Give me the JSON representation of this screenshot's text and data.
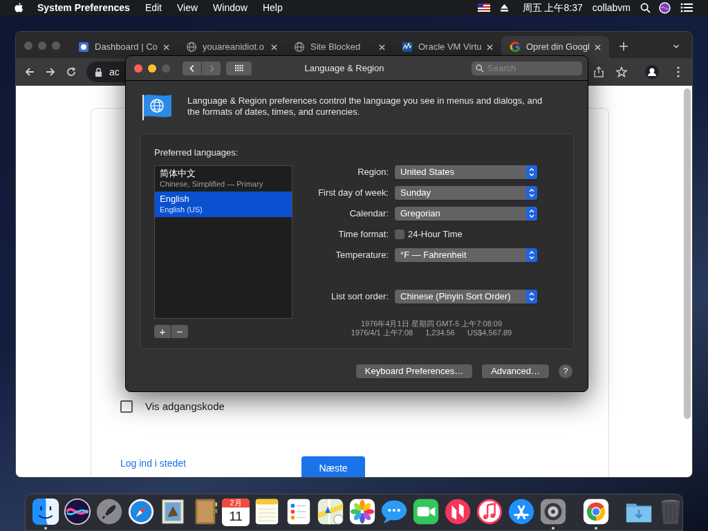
{
  "menubar": {
    "app": "System Preferences",
    "menus": [
      "Edit",
      "View",
      "Window",
      "Help"
    ],
    "clock": "周五 上午8:37",
    "user": "collabvm"
  },
  "browser": {
    "tabs": [
      {
        "title": "Dashboard | Co",
        "kind": "app",
        "selected": false
      },
      {
        "title": "youareanidiot.o",
        "kind": "globe",
        "selected": false
      },
      {
        "title": "Site Blocked",
        "kind": "globe",
        "selected": false
      },
      {
        "title": "Oracle VM Virtu",
        "kind": "chart",
        "selected": false
      },
      {
        "title": "Opret din Googl",
        "kind": "ring",
        "selected": true
      }
    ],
    "address": "ac",
    "page": {
      "show_password": {
        "label": "Vis adgangskode",
        "checked": false
      },
      "link": "Log ind i stedet",
      "next_button": "Næste"
    }
  },
  "prefs": {
    "title": "Language & Region",
    "search_placeholder": "Search",
    "nav": {
      "back_disabled": false,
      "forward_disabled": true
    },
    "description": "Language & Region preferences control the language you see in menus and dialogs, and the formats of dates, times, and currencies.",
    "preferred_label": "Preferred languages:",
    "languages": [
      {
        "name": "简体中文",
        "detail": "Chinese, Simplified — Primary",
        "selected": false
      },
      {
        "name": "English",
        "detail": "English (US)",
        "selected": true
      }
    ],
    "add": "+",
    "remove": "−",
    "settings": [
      {
        "kind": "popup",
        "label": "Region:",
        "value": "United States"
      },
      {
        "kind": "popup",
        "label": "First day of week:",
        "value": "Sunday"
      },
      {
        "kind": "popup",
        "label": "Calendar:",
        "value": "Gregorian"
      },
      {
        "kind": "checkbox",
        "label": "Time format:",
        "value": "24-Hour Time",
        "checked": false
      },
      {
        "kind": "popup",
        "label": "Temperature:",
        "value": "°F — Fahrenheit"
      },
      {
        "kind": "spacer"
      },
      {
        "kind": "popup",
        "label": "List sort order:",
        "value": "Chinese (Pinyin Sort Order)"
      }
    ],
    "samples": [
      [
        "1976年4月1日 星期四 GMT-5 上午7:08:09"
      ],
      [
        "1976/4/1 上午7:08",
        "1,234.56",
        "US$4,567.89"
      ]
    ],
    "buttons": [
      "Keyboard Preferences…",
      "Advanced…"
    ],
    "help": "?"
  },
  "dock": {
    "items": [
      {
        "kind": "finder",
        "running": true
      },
      {
        "kind": "siri",
        "running": false
      },
      {
        "kind": "launchpad",
        "running": false
      },
      {
        "kind": "safari",
        "running": false
      },
      {
        "kind": "mail",
        "running": false
      },
      {
        "kind": "contacts",
        "running": false
      },
      {
        "kind": "calendar",
        "month": "2月",
        "day": "11",
        "running": false
      },
      {
        "kind": "notes",
        "running": false
      },
      {
        "kind": "reminders",
        "running": false
      },
      {
        "kind": "maps",
        "running": false
      },
      {
        "kind": "photos",
        "running": false
      },
      {
        "kind": "messages",
        "running": false
      },
      {
        "kind": "facetime",
        "running": false
      },
      {
        "kind": "news",
        "running": false
      },
      {
        "kind": "music",
        "running": false
      },
      {
        "kind": "appstore",
        "running": false
      },
      {
        "kind": "settings",
        "running": true
      },
      {
        "kind": "separator"
      },
      {
        "kind": "chrome",
        "running": true
      },
      {
        "kind": "separator"
      },
      {
        "kind": "downloads",
        "running": false
      },
      {
        "kind": "trash",
        "running": false
      }
    ]
  }
}
